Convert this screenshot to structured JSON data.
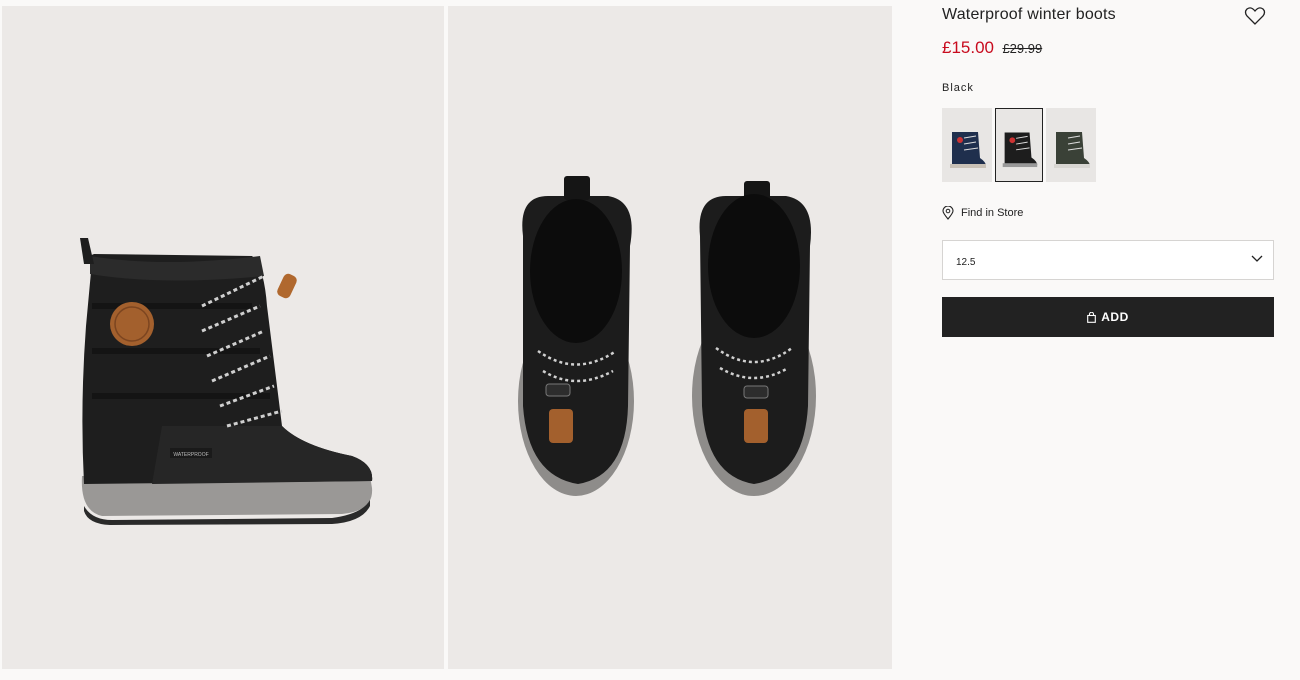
{
  "product": {
    "title": "Waterproof winter boots",
    "price_current": "£15.00",
    "price_original": "£29.99",
    "color_selected": "Black",
    "swatches": [
      {
        "name": "navy",
        "color": "#1f2f4d"
      },
      {
        "name": "black",
        "color": "#1d1d1d"
      },
      {
        "name": "dark-green",
        "color": "#3a4137"
      }
    ],
    "find_in_store_label": "Find in Store",
    "size_value": "12.5",
    "add_label": "ADD"
  },
  "images": {
    "side_view_brand_text": "WATERPROOF"
  },
  "colors": {
    "price_sale": "#c80b1e",
    "button_bg": "#222222",
    "photo_bg": "#ece9e7",
    "page_bg": "#faf9f8"
  }
}
